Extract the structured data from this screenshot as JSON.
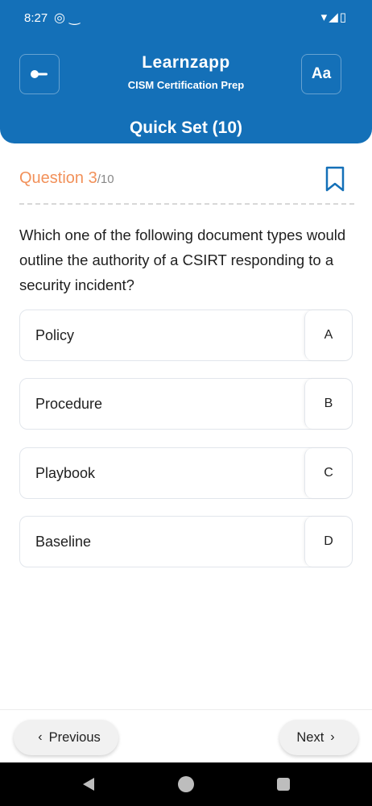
{
  "status_bar": {
    "time": "8:27",
    "left_icons": [
      "location-icon",
      "tilde-icon"
    ],
    "right_icons": [
      "wifi-icon",
      "signal-icon",
      "battery-icon"
    ]
  },
  "header": {
    "back_icon": "back-arrow-icon",
    "logo_text": "Learnzapp",
    "subtitle": "CISM Certification Prep",
    "font_button_label": "Aa",
    "set_title": "Quick Set (10)",
    "bg_color": "#1470b8"
  },
  "question": {
    "label": "Question 3",
    "total": "/10",
    "text": "Which one of the following document types would outline the authority of a CSIRT responding to a security incident?",
    "accent_color": "#f2915a"
  },
  "options": [
    {
      "text": "Policy",
      "letter": "A"
    },
    {
      "text": "Procedure",
      "letter": "B"
    },
    {
      "text": "Playbook",
      "letter": "C"
    },
    {
      "text": "Baseline",
      "letter": "D"
    }
  ],
  "navigation": {
    "previous_label": "Previous",
    "next_label": "Next"
  }
}
